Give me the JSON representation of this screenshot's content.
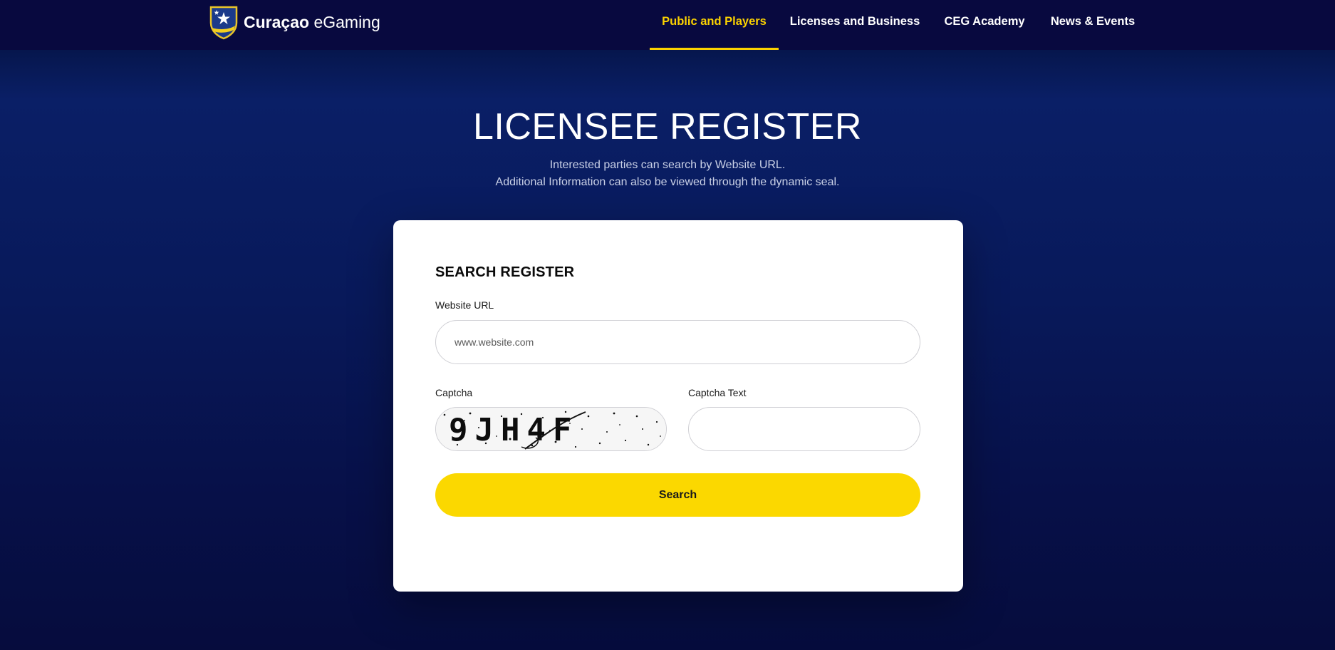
{
  "header": {
    "brand_bold": "Curaçao",
    "brand_light": "eGaming",
    "logo_icon": "shield-star-icon",
    "nav": [
      {
        "label": "Public and Players",
        "active": true
      },
      {
        "label": "Licenses and Business",
        "active": false
      },
      {
        "label": "CEG Academy",
        "active": false
      },
      {
        "label": "News & Events",
        "active": false
      }
    ]
  },
  "hero": {
    "title": "LICENSEE REGISTER",
    "subtitle_line1": "Interested parties can search by Website URL.",
    "subtitle_line2": "Additional Information can also be viewed through the dynamic seal."
  },
  "search_card": {
    "title": "SEARCH REGISTER",
    "website_label": "Website URL",
    "website_placeholder": "www.website.com",
    "website_value": "",
    "captcha_label": "Captcha",
    "captcha_text_label": "Captcha Text",
    "captcha_text_value": "",
    "captcha_image_text": "9JH4F",
    "search_button_label": "Search"
  },
  "colors": {
    "accent_yellow": "#fbd800",
    "nav_background": "#08093f",
    "page_background": "#0a1f66"
  }
}
